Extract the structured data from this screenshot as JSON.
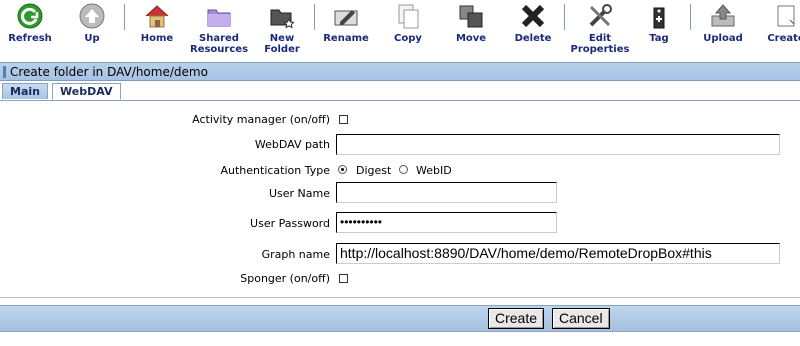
{
  "toolbar": {
    "items": [
      {
        "label": "Refresh",
        "icon": "refresh-icon"
      },
      {
        "label": "Up",
        "icon": "up-arrow-icon"
      },
      {
        "label": "Home",
        "icon": "home-icon"
      },
      {
        "label": "Shared Resources",
        "icon": "shared-folder-icon"
      },
      {
        "label": "New Folder",
        "icon": "new-folder-icon"
      },
      {
        "label": "Rename",
        "icon": "rename-icon"
      },
      {
        "label": "Copy",
        "icon": "copy-icon"
      },
      {
        "label": "Move",
        "icon": "move-icon"
      },
      {
        "label": "Delete",
        "icon": "delete-icon"
      },
      {
        "label": "Edit Properties",
        "icon": "tools-icon"
      },
      {
        "label": "Tag",
        "icon": "tag-icon"
      },
      {
        "label": "Upload",
        "icon": "upload-icon"
      },
      {
        "label": "Create",
        "icon": "create-icon"
      }
    ]
  },
  "title": "Create folder in DAV/home/demo",
  "tabs": [
    {
      "label": "Main",
      "active": false
    },
    {
      "label": "WebDAV",
      "active": true
    }
  ],
  "form": {
    "activity_manager_label": "Activity manager (on/off)",
    "activity_manager_checked": false,
    "webdav_path_label": "WebDAV path",
    "webdav_path_value": "",
    "auth_type_label": "Authentication Type",
    "auth_options": [
      {
        "label": "Digest",
        "selected": true
      },
      {
        "label": "WebID",
        "selected": false
      }
    ],
    "user_name_label": "User Name",
    "user_name_value": "",
    "user_password_label": "User Password",
    "user_password_value": "••••••••••",
    "graph_name_label": "Graph name",
    "graph_name_value": "http://localhost:8890/DAV/home/demo/RemoteDropBox#this",
    "sponger_label": "Sponger (on/off)",
    "sponger_checked": false
  },
  "buttons": {
    "create": "Create",
    "cancel": "Cancel"
  },
  "colors": {
    "title_bar": "#a6c3e3",
    "toolbar_text": "#1a2a7a",
    "refresh_green": "#2e9a2e"
  }
}
